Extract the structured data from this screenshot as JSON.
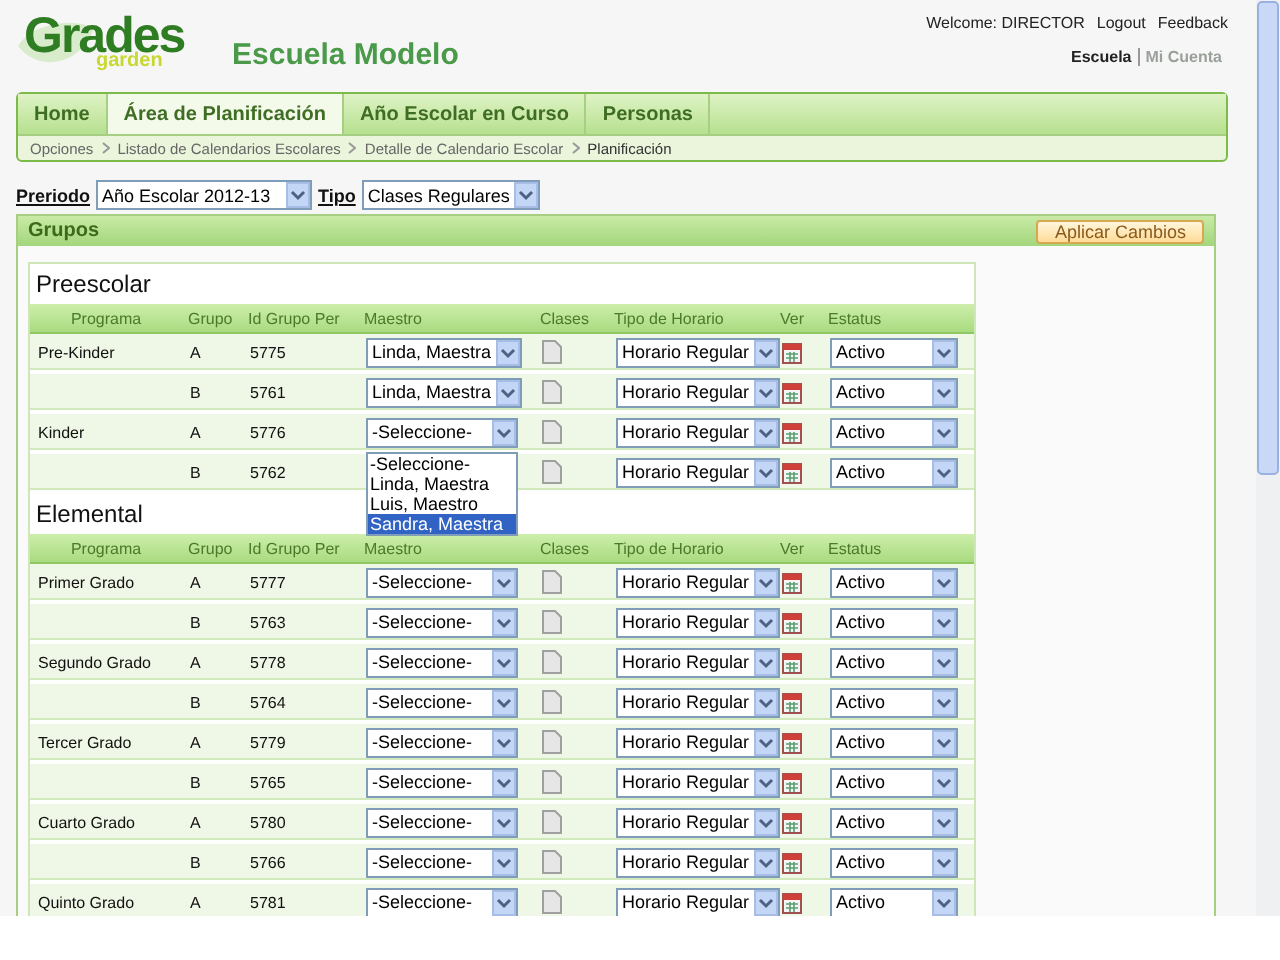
{
  "header": {
    "logo_top": "Grades",
    "logo_bottom": "garden",
    "school": "Escuela Modelo",
    "welcome": "Welcome: DIRECTOR",
    "links": [
      "Logout",
      "Feedback"
    ],
    "context": [
      {
        "label": "Escuela",
        "selected": true
      },
      {
        "label": "Mi Cuenta",
        "selected": false
      }
    ]
  },
  "tabs": [
    {
      "label": "Home",
      "selected": false
    },
    {
      "label": "Área de Planificación",
      "selected": true
    },
    {
      "label": "Año Escolar en Curso",
      "selected": false
    },
    {
      "label": "Personas",
      "selected": false
    }
  ],
  "breadcrumb": [
    "Opciones",
    "Listado de Calendarios Escolares",
    "Detalle de Calendario Escolar",
    "Planificación"
  ],
  "filters": [
    {
      "label": "Preriodo",
      "value": "Año Escolar 2012-13"
    },
    {
      "label": "Tipo",
      "value": "Clases Regulares"
    }
  ],
  "panel": {
    "title": "Grupos",
    "button": "Aplicar Cambios"
  },
  "sections": [
    {
      "title": "Preescolar",
      "columns": [
        "Programa",
        "Grupo",
        "Id Grupo Per",
        "Maestro",
        "Clases",
        "Tipo de Horario",
        "Ver",
        "Estatus"
      ],
      "rows": [
        {
          "programa": "Pre-Kinder",
          "grupo": "A",
          "id": "5775",
          "maestro": "Linda, Maestra",
          "tipo": "Horario Regular",
          "estatus": "Activo"
        },
        {
          "grupo": "B",
          "id": "5761",
          "maestro": "Linda, Maestra",
          "tipo": "Horario Regular",
          "estatus": "Activo"
        },
        {
          "programa": "Kinder",
          "grupo": "A",
          "id": "5776",
          "maestro": "-Seleccione-",
          "tipo": "Horario Regular",
          "estatus": "Activo",
          "maestro_menu": [
            {
              "label": "-Seleccione-",
              "selected": false
            },
            {
              "label": "Linda, Maestra",
              "selected": false
            },
            {
              "label": "Luis, Maestro",
              "selected": false
            },
            {
              "label": "Sandra, Maestra",
              "selected": true
            }
          ]
        },
        {
          "grupo": "B",
          "id": "5762",
          "tipo": "Horario Regular",
          "estatus": "Activo"
        }
      ]
    },
    {
      "title": "Elemental",
      "columns": [
        "Programa",
        "Grupo",
        "Id Grupo Per",
        "Maestro",
        "Clases",
        "Tipo de Horario",
        "Ver",
        "Estatus"
      ],
      "rows": [
        {
          "programa": "Primer Grado",
          "grupo": "A",
          "id": "5777",
          "maestro": "-Seleccione-",
          "tipo": "Horario Regular",
          "estatus": "Activo"
        },
        {
          "grupo": "B",
          "id": "5763",
          "maestro": "-Seleccione-",
          "tipo": "Horario Regular",
          "estatus": "Activo"
        },
        {
          "programa": "Segundo Grado",
          "grupo": "A",
          "id": "5778",
          "maestro": "-Seleccione-",
          "tipo": "Horario Regular",
          "estatus": "Activo"
        },
        {
          "grupo": "B",
          "id": "5764",
          "maestro": "-Seleccione-",
          "tipo": "Horario Regular",
          "estatus": "Activo"
        },
        {
          "programa": "Tercer Grado",
          "grupo": "A",
          "id": "5779",
          "maestro": "-Seleccione-",
          "tipo": "Horario Regular",
          "estatus": "Activo"
        },
        {
          "grupo": "B",
          "id": "5765",
          "maestro": "-Seleccione-",
          "tipo": "Horario Regular",
          "estatus": "Activo"
        },
        {
          "programa": "Cuarto Grado",
          "grupo": "A",
          "id": "5780",
          "maestro": "-Seleccione-",
          "tipo": "Horario Regular",
          "estatus": "Activo"
        },
        {
          "grupo": "B",
          "id": "5766",
          "maestro": "-Seleccione-",
          "tipo": "Horario Regular",
          "estatus": "Activo"
        },
        {
          "programa": "Quinto Grado",
          "grupo": "A",
          "id": "5781",
          "maestro": "-Seleccione-",
          "tipo": "Horario Regular",
          "estatus": "Activo"
        }
      ]
    }
  ]
}
